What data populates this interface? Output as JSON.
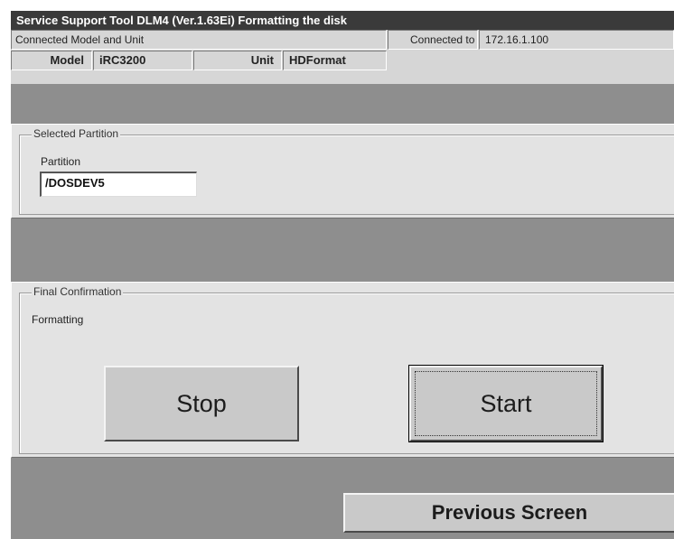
{
  "window": {
    "title": "Service Support Tool DLM4 (Ver.1.63Ei) Formatting the disk"
  },
  "info": {
    "connected_model_unit_label": "Connected Model and Unit",
    "connected_to_label": "Connected to",
    "connected_to_value": "172.16.1.100",
    "model_label": "Model",
    "model_value": "iRC3200",
    "unit_label": "Unit",
    "unit_value": "HDFormat"
  },
  "selected_partition": {
    "group_title": "Selected Partition",
    "partition_label": "Partition",
    "partition_value": "/DOSDEV5"
  },
  "final_confirmation": {
    "group_title": "Final Confirmation",
    "status_text": "Formatting"
  },
  "buttons": {
    "stop": "Stop",
    "start": "Start",
    "previous_screen": "Previous Screen"
  }
}
